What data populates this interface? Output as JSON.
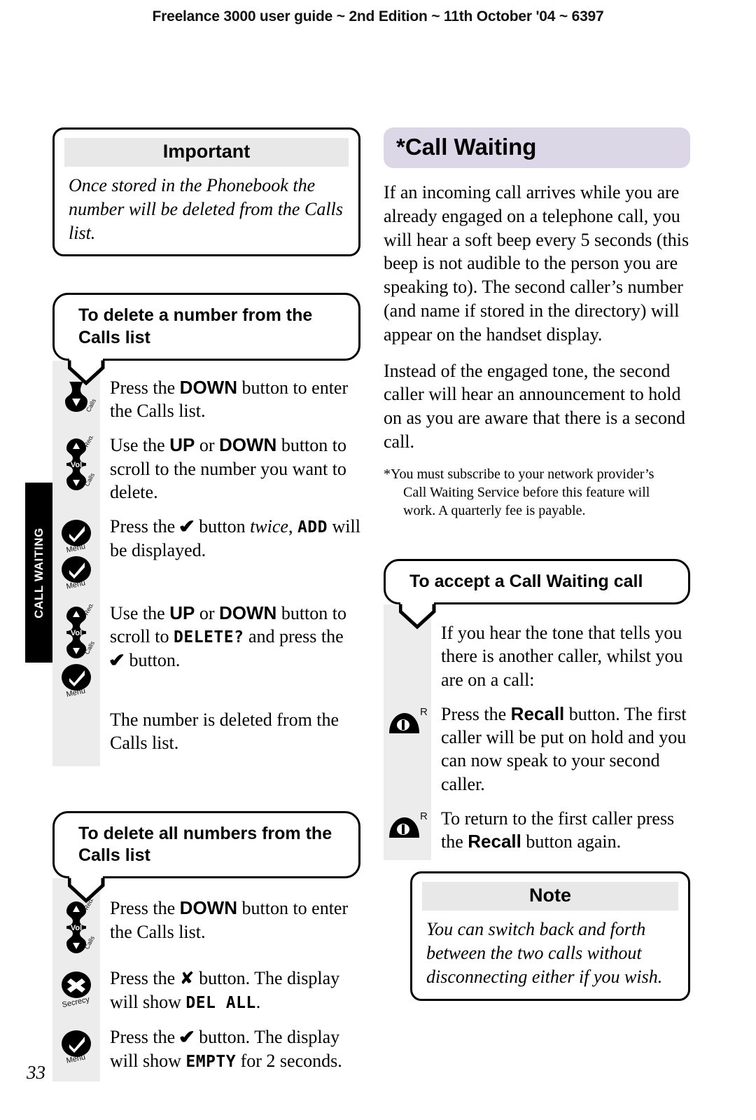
{
  "header": {
    "running_head": "Freelance 3000 user guide ~ 2nd Edition ~ 11th October '04 ~ 6397"
  },
  "side_tab": {
    "label": "CALL WAITING"
  },
  "page_number": "33",
  "left_column": {
    "important_box": {
      "title": "Important",
      "body": "Once stored in the Phonebook the number will be deleted from the Calls list."
    },
    "section_delete_one": {
      "heading": "To delete a number from the Calls list",
      "steps": [
        {
          "icon": "down-arrow-calls-button-icon",
          "icon_label": "Calls",
          "text_parts": [
            {
              "t": "Press the ",
              "s": "plain"
            },
            {
              "t": "DOWN",
              "s": "bold"
            },
            {
              "t": " button to enter the Calls list.",
              "s": "plain"
            }
          ]
        },
        {
          "icon": "up-down-rocker-button-icon",
          "icon_label": "Redial / Vol / Calls",
          "text_parts": [
            {
              "t": "Use the ",
              "s": "plain"
            },
            {
              "t": "UP",
              "s": "bold"
            },
            {
              "t": " or ",
              "s": "plain"
            },
            {
              "t": "DOWN",
              "s": "bold"
            },
            {
              "t": " button to scroll to the number you want to delete.",
              "s": "plain"
            }
          ]
        },
        {
          "icon": "double-tick-menu-button-icon",
          "icon_label": "Menu",
          "text_parts": [
            {
              "t": "Press the ",
              "s": "plain"
            },
            {
              "t": "✔",
              "s": "tick"
            },
            {
              "t": " button ",
              "s": "plain"
            },
            {
              "t": "twice",
              "s": "italic"
            },
            {
              "t": ", ",
              "s": "plain"
            },
            {
              "t": "ADD",
              "s": "lcd"
            },
            {
              "t": " will be displayed.",
              "s": "plain"
            }
          ]
        },
        {
          "icon": "up-down-rocker-button-icon",
          "icon_label": "Redial / Vol / Calls",
          "text_parts": [
            {
              "t": "Use the ",
              "s": "plain"
            },
            {
              "t": "UP",
              "s": "bold"
            },
            {
              "t": " or ",
              "s": "plain"
            },
            {
              "t": "DOWN",
              "s": "bold"
            },
            {
              "t": " button to scroll to ",
              "s": "plain"
            },
            {
              "t": "DELETE?",
              "s": "lcd"
            },
            {
              "t": " and press the ",
              "s": "plain"
            },
            {
              "t": "✔",
              "s": "tick"
            },
            {
              "t": " button.",
              "s": "plain"
            }
          ]
        },
        {
          "icon": "none",
          "icon_label": "",
          "text_parts": [
            {
              "t": "The number is deleted from the Calls list.",
              "s": "plain"
            }
          ]
        }
      ]
    },
    "section_delete_all": {
      "heading": "To delete all numbers from the Calls list",
      "steps": [
        {
          "icon": "up-down-rocker-button-icon",
          "icon_label": "Redial / Vol / Calls",
          "text_parts": [
            {
              "t": "Press the ",
              "s": "plain"
            },
            {
              "t": "DOWN",
              "s": "bold"
            },
            {
              "t": " button to enter the Calls list.",
              "s": "plain"
            }
          ]
        },
        {
          "icon": "cross-secrecy-button-icon",
          "icon_label": "Secrecy",
          "text_parts": [
            {
              "t": "Press the ",
              "s": "plain"
            },
            {
              "t": "✘",
              "s": "cross"
            },
            {
              "t": " button. The display will show ",
              "s": "plain"
            },
            {
              "t": "DEL ALL",
              "s": "lcd"
            },
            {
              "t": ".",
              "s": "plain"
            }
          ]
        },
        {
          "icon": "tick-menu-button-icon",
          "icon_label": "Menu",
          "text_parts": [
            {
              "t": "Press the ",
              "s": "plain"
            },
            {
              "t": "✔",
              "s": "tick"
            },
            {
              "t": " button. The display will show ",
              "s": "plain"
            },
            {
              "t": "EMPTY",
              "s": "lcd"
            },
            {
              "t": " for 2 seconds.",
              "s": "plain"
            }
          ]
        }
      ]
    }
  },
  "right_column": {
    "title": "*Call Waiting",
    "title_bg": "#dcd7e6",
    "paragraphs": [
      "If an incoming call arrives while you are already engaged on a telephone call, you will hear a soft beep every 5 seconds (this beep is not audible to the person you are speaking to). The second caller’s number (and name if stored in the directory) will appear on the handset display.",
      "Instead of the engaged tone, the second caller will hear an announcement to hold on as you are aware that there is a second call."
    ],
    "footnote": {
      "line1": "*You must subscribe to your network provider’s",
      "line2": "Call Waiting Service before this feature will",
      "line3": "work. A quarterly fee is payable."
    },
    "section_accept": {
      "heading": "To accept a Call Waiting call",
      "steps": [
        {
          "icon": "none",
          "icon_label": "",
          "text_parts": [
            {
              "t": "If you hear the tone that tells you there is another caller, whilst you are on a call:",
              "s": "plain"
            }
          ]
        },
        {
          "icon": "recall-button-icon",
          "icon_label": "R",
          "text_parts": [
            {
              "t": "Press the ",
              "s": "plain"
            },
            {
              "t": "Recall",
              "s": "bold"
            },
            {
              "t": " button. The first caller will be put on hold and you can now speak to your second caller.",
              "s": "plain"
            }
          ]
        },
        {
          "icon": "recall-button-icon",
          "icon_label": "R",
          "text_parts": [
            {
              "t": "To return to the first caller press the ",
              "s": "plain"
            },
            {
              "t": "Recall",
              "s": "bold"
            },
            {
              "t": " button again.",
              "s": "plain"
            }
          ]
        }
      ]
    },
    "note_box": {
      "title": "Note",
      "body": "You can switch back and forth between the two calls without disconnecting either if you wish."
    }
  }
}
